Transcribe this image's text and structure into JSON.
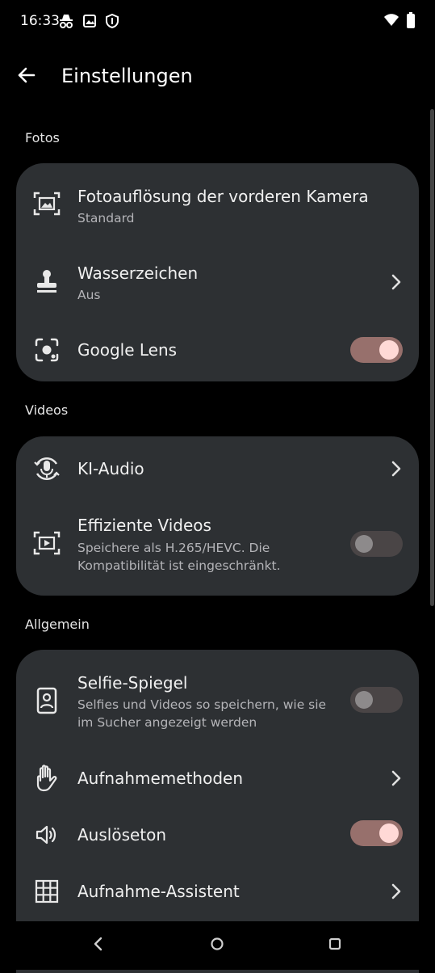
{
  "status_bar": {
    "time": "16:33",
    "left_icons": [
      "incognito-icon",
      "image-icon",
      "shield-icon"
    ],
    "right_icons": [
      "wifi-icon",
      "battery-icon"
    ]
  },
  "app_bar": {
    "title": "Einstellungen",
    "back_icon": "arrow-left-icon"
  },
  "sections": {
    "photos": {
      "header": "Fotos",
      "items": [
        {
          "title": "Fotoauflösung der vorderen Kamera",
          "subtitle": "Standard",
          "icon": "photo-resolution-icon"
        },
        {
          "title": "Wasserzeichen",
          "subtitle": "Aus",
          "icon": "stamp-icon",
          "control": "chevron"
        },
        {
          "title": "Google Lens",
          "icon": "lens-icon",
          "control": "toggle",
          "on": true
        }
      ]
    },
    "videos": {
      "header": "Videos",
      "items": [
        {
          "title": "KI-Audio",
          "icon": "ai-audio-mic-icon",
          "control": "chevron"
        },
        {
          "title": "Effiziente Videos",
          "subtitle": "Speichere als H.265/HEVC. Die Kompatibilität ist eingeschränkt.",
          "icon": "video-icon",
          "control": "toggle",
          "on": false
        }
      ]
    },
    "general": {
      "header": "Allgemein",
      "items": [
        {
          "title": "Selfie-Spiegel",
          "subtitle": "Selfies und Videos so speichern, wie sie im Sucher angezeigt werden",
          "icon": "selfie-portrait-icon",
          "control": "toggle",
          "on": false
        },
        {
          "title": "Aufnahmemethoden",
          "icon": "hand-icon",
          "control": "chevron"
        },
        {
          "title": "Auslöseton",
          "icon": "volume-icon",
          "control": "toggle",
          "on": true
        },
        {
          "title": "Aufnahme-Assistent",
          "icon": "grid-icon",
          "control": "chevron"
        }
      ]
    }
  },
  "nav_bar": {
    "icons": [
      "nav-back-icon",
      "nav-home-icon",
      "nav-recents-icon"
    ]
  },
  "colors": {
    "background": "#000000",
    "card": "#2d3033",
    "toggle_on_track": "#97706c",
    "toggle_on_knob": "#ffd9d6",
    "toggle_off_track": "#4a4546",
    "toggle_off_knob": "#8d8a8b"
  }
}
